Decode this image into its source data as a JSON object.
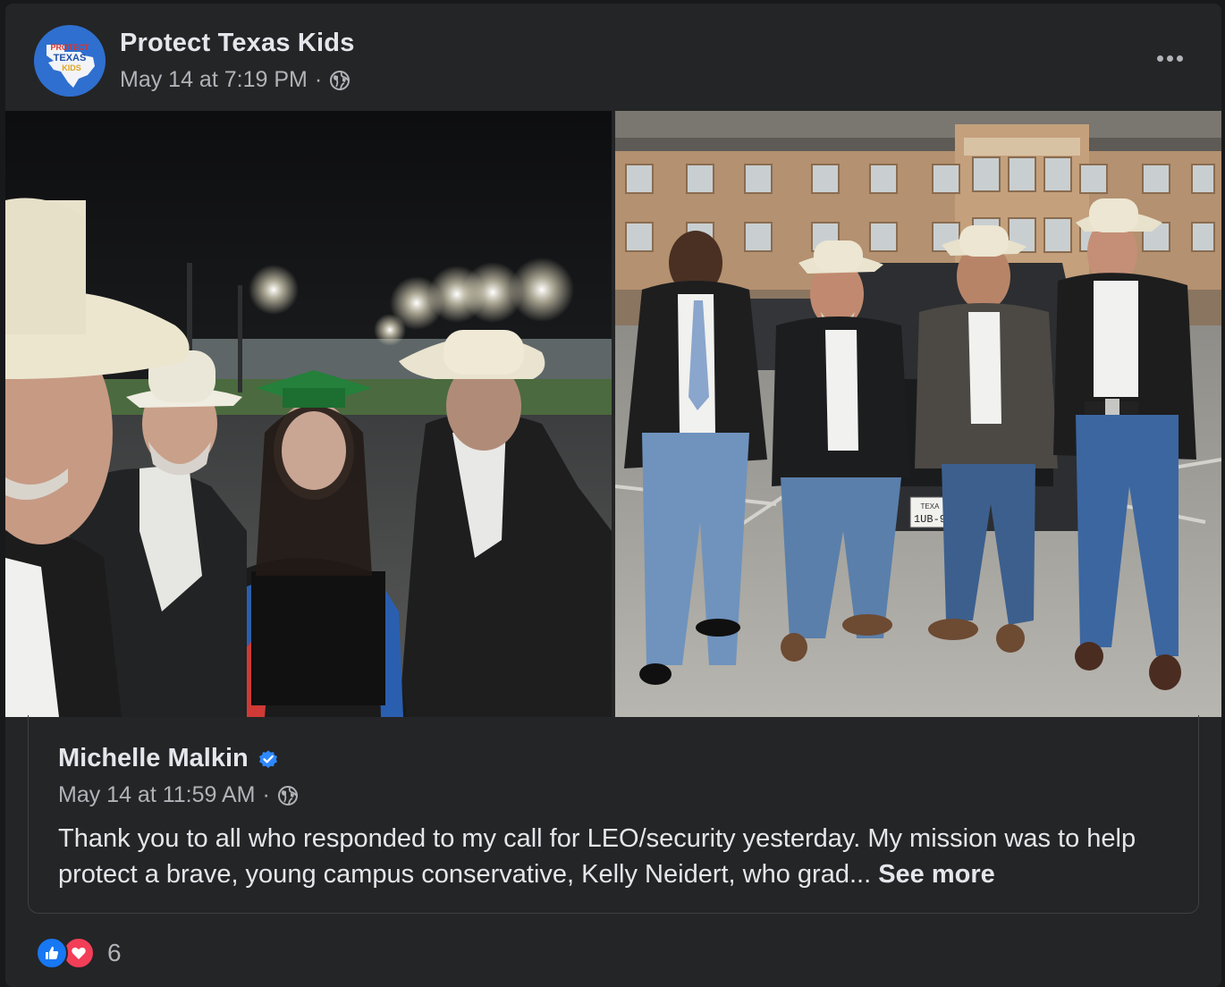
{
  "post": {
    "page_name": "Protect Texas Kids",
    "timestamp": "May 14 at 7:19 PM",
    "separator": "·",
    "privacy_icon": "globe-icon",
    "more_icon": "more-options-icon",
    "avatar_logo_text": [
      "PROTECT",
      "TEXAS",
      "KIDS"
    ]
  },
  "photos": [
    {
      "name": "graduation-selfie-photo"
    },
    {
      "name": "security-team-photo",
      "license_plate": "1UB-9",
      "plate_state": "TEXA"
    }
  ],
  "shared_post": {
    "author": "Michelle Malkin",
    "verified_icon": "verified-badge-icon",
    "timestamp": "May 14 at 11:59 AM",
    "separator": "·",
    "text": "Thank you to all who responded to my call for LEO/security yesterday. My mission was to help protect a brave, young campus conservative, Kelly Neidert, who grad...",
    "see_more": "See more"
  },
  "reactions": {
    "icons": [
      "like-icon",
      "love-icon"
    ],
    "count": "6"
  },
  "colors": {
    "card_bg": "#242526",
    "page_bg": "#18191a",
    "text_primary": "#e4e6eb",
    "text_secondary": "#b0b3b8",
    "like_blue": "#1877f2",
    "love_red": "#f33e58"
  }
}
